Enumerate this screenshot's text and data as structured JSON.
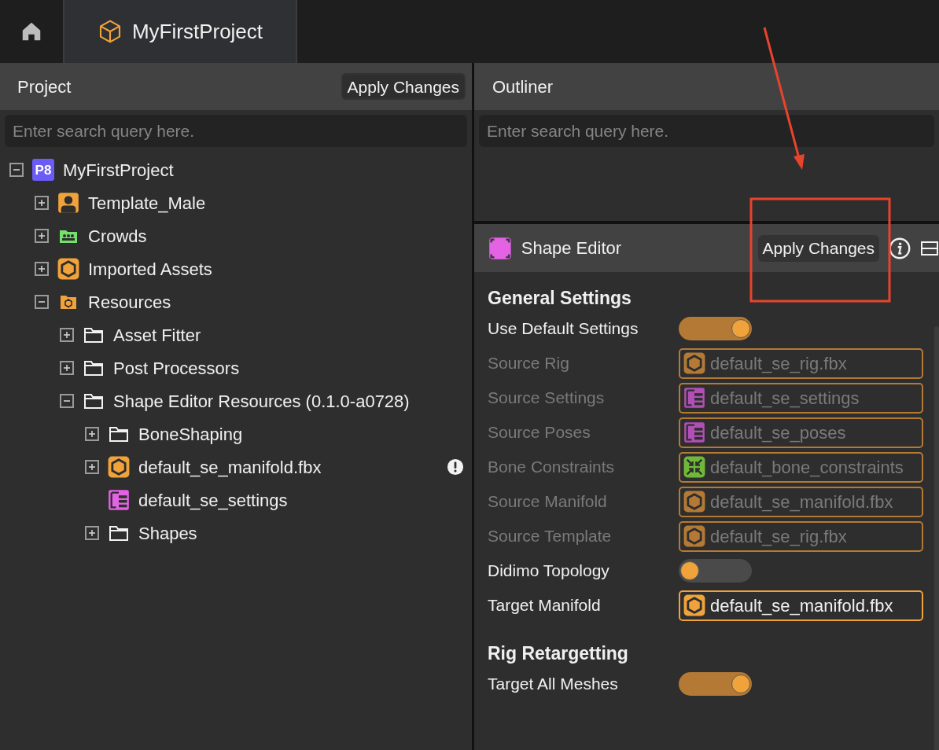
{
  "tabs": [
    {
      "kind": "home",
      "selected": false
    },
    {
      "kind": "project",
      "label": "MyFirstProject",
      "selected": true
    }
  ],
  "project_panel": {
    "title": "Project",
    "apply_button": "Apply Changes",
    "search": {
      "placeholder": "Enter search query here."
    },
    "tree": [
      {
        "label": "MyFirstProject",
        "kind": "p8",
        "badge": "P8",
        "expanded": true,
        "leaf": false,
        "warning": false,
        "children": [
          {
            "label": "Template_Male",
            "kind": "person",
            "expanded": false,
            "leaf": false,
            "warning": false
          },
          {
            "label": "Crowds",
            "kind": "crowd",
            "expanded": false,
            "leaf": false,
            "warning": false
          },
          {
            "label": "Imported Assets",
            "kind": "asset",
            "expanded": false,
            "leaf": false,
            "warning": false
          },
          {
            "label": "Resources",
            "kind": "resources",
            "expanded": true,
            "leaf": false,
            "warning": false,
            "children": [
              {
                "label": "Asset Fitter",
                "kind": "folder",
                "expanded": false,
                "leaf": false,
                "warning": false
              },
              {
                "label": "Post Processors",
                "kind": "folder",
                "expanded": false,
                "leaf": false,
                "warning": false
              },
              {
                "label": "Shape Editor Resources (0.1.0-a0728)",
                "kind": "folder",
                "expanded": true,
                "leaf": false,
                "warning": false,
                "children": [
                  {
                    "label": "BoneShaping",
                    "kind": "folder",
                    "expanded": false,
                    "leaf": false,
                    "warning": false
                  },
                  {
                    "label": "default_se_manifold.fbx",
                    "kind": "asset",
                    "expanded": false,
                    "leaf": false,
                    "warning": true
                  },
                  {
                    "label": "default_se_settings",
                    "kind": "settings",
                    "expanded": false,
                    "leaf": true,
                    "warning": false
                  },
                  {
                    "label": "Shapes",
                    "kind": "folder",
                    "expanded": false,
                    "leaf": false,
                    "warning": false
                  }
                ]
              }
            ]
          }
        ]
      }
    ]
  },
  "outliner_panel": {
    "title": "Outliner",
    "search": {
      "placeholder": "Enter search query here."
    }
  },
  "shape_editor": {
    "title": "Shape Editor",
    "apply_button": "Apply Changes",
    "sections": [
      {
        "title": "General Settings",
        "rows": [
          {
            "kind": "toggle",
            "label": "Use Default Settings",
            "on": true,
            "disabled": false
          },
          {
            "kind": "asset",
            "label": "Source Rig",
            "value": "default_se_rig.fbx",
            "disabled": true
          },
          {
            "kind": "settings",
            "label": "Source Settings",
            "value": "default_se_settings",
            "disabled": true
          },
          {
            "kind": "settings",
            "label": "Source Poses",
            "value": "default_se_poses",
            "disabled": true
          },
          {
            "kind": "constraints",
            "label": "Bone Constraints",
            "value": "default_bone_constraints",
            "disabled": true
          },
          {
            "kind": "asset",
            "label": "Source Manifold",
            "value": "default_se_manifold.fbx",
            "disabled": true
          },
          {
            "kind": "asset",
            "label": "Source Template",
            "value": "default_se_rig.fbx",
            "disabled": true
          },
          {
            "kind": "toggle",
            "label": "Didimo Topology",
            "on": false,
            "disabled": false
          },
          {
            "kind": "asset",
            "label": "Target Manifold",
            "value": "default_se_manifold.fbx",
            "disabled": false
          }
        ]
      },
      {
        "title": "Rig Retargetting",
        "rows": [
          {
            "kind": "toggle",
            "label": "Target All Meshes",
            "on": true,
            "disabled": false
          }
        ]
      }
    ]
  }
}
